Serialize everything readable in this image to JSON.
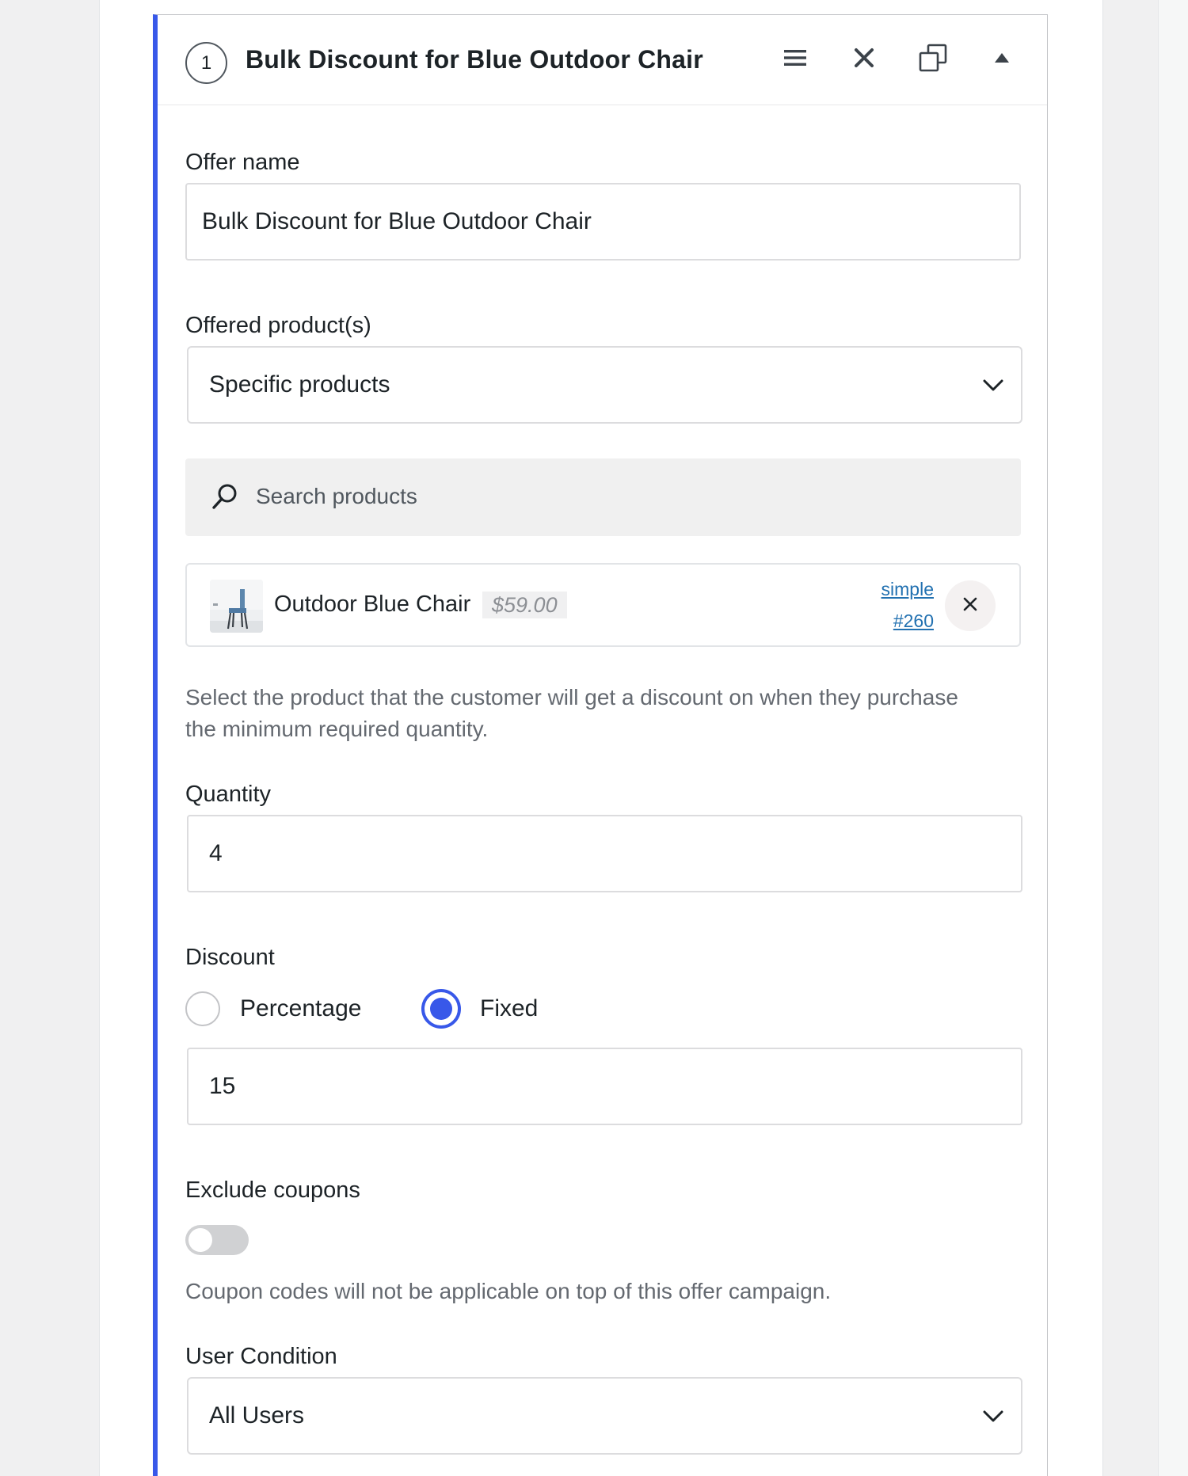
{
  "offer": {
    "step_number": "1",
    "title": "Bulk Discount for Blue Outdoor Chair",
    "header_icons": [
      "menu-icon",
      "close-icon",
      "duplicate-icon",
      "caret-up-icon"
    ]
  },
  "fields": {
    "offer_name": {
      "label": "Offer name",
      "value": "Bulk Discount for Blue Outdoor Chair"
    },
    "offered_products": {
      "label": "Offered product(s)",
      "selected": "Specific products",
      "search_placeholder": "Search products",
      "selected_product": {
        "name": "Outdoor Blue Chair",
        "price": "$59.00",
        "type": "simple",
        "id": "#260"
      },
      "help": "Select the product that the customer will get a discount on when they purchase the minimum required quantity."
    },
    "quantity": {
      "label": "Quantity",
      "value": "4"
    },
    "discount": {
      "label": "Discount",
      "options": [
        {
          "label": "Percentage",
          "checked": false
        },
        {
          "label": "Fixed",
          "checked": true
        }
      ],
      "value": "15"
    },
    "exclude_coupons": {
      "label": "Exclude coupons",
      "enabled": false,
      "help": "Coupon codes will not be applicable on top of this offer campaign."
    },
    "user_condition": {
      "label": "User Condition",
      "selected": "All Users"
    }
  },
  "colors": {
    "accent": "#3858e9",
    "link": "#2271b1",
    "text": "#1d2327",
    "muted": "#646970"
  }
}
